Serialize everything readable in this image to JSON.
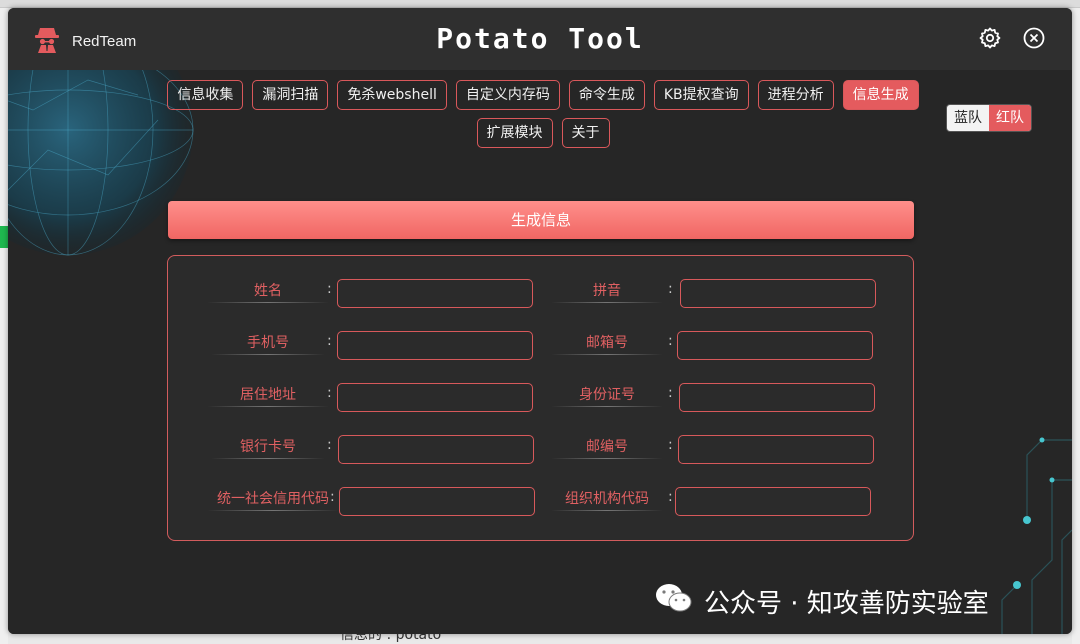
{
  "app": {
    "brand": "RedTeam",
    "title": "Potato Tool"
  },
  "tabs": [
    {
      "label": "信息收集",
      "active": false
    },
    {
      "label": "漏洞扫描",
      "active": false
    },
    {
      "label": "免杀webshell",
      "active": false
    },
    {
      "label": "自定义内存码",
      "active": false
    },
    {
      "label": "命令生成",
      "active": false
    },
    {
      "label": "KB提权查询",
      "active": false
    },
    {
      "label": "进程分析",
      "active": false
    },
    {
      "label": "信息生成",
      "active": true
    },
    {
      "label": "扩展模块",
      "active": false
    },
    {
      "label": "关于",
      "active": false
    }
  ],
  "team_toggle": {
    "blue": "蓝队",
    "red": "红队",
    "selected": "红队"
  },
  "generate_button": "生成信息",
  "form": {
    "name": {
      "label": "姓名",
      "value": ""
    },
    "pinyin": {
      "label": "拼音",
      "value": ""
    },
    "phone": {
      "label": "手机号",
      "value": ""
    },
    "email": {
      "label": "邮箱号",
      "value": ""
    },
    "address": {
      "label": "居住地址",
      "value": ""
    },
    "id_card": {
      "label": "身份证号",
      "value": ""
    },
    "bank_card": {
      "label": "银行卡号",
      "value": ""
    },
    "postcode": {
      "label": "邮编号",
      "value": ""
    },
    "credit_code": {
      "label": "统一社会信用代码",
      "value": ""
    },
    "org_code": {
      "label": "组织机构代码",
      "value": ""
    },
    "colon": ":"
  },
  "watermark": "公众号 · 知攻善防实验室",
  "background_text": "信息的 : potato",
  "colors": {
    "accent": "#e45b5e",
    "panel_border": "#d25c5d",
    "background": "#262626"
  },
  "icons": [
    "hacker-logo-icon",
    "gear-icon",
    "close-icon",
    "wechat-icon"
  ]
}
